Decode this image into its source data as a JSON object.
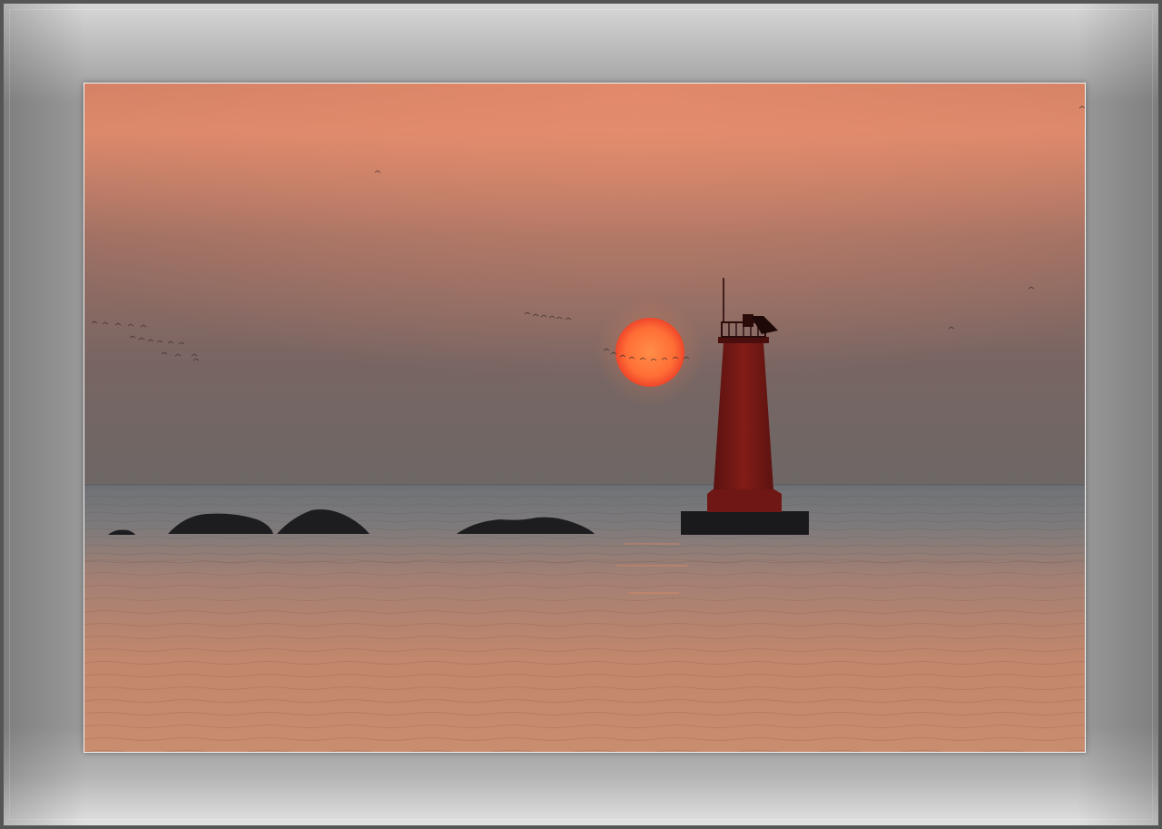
{
  "scene": {
    "subject": "lighthouse-at-sunset",
    "colors": {
      "sky_top": "#d9876a",
      "sky_mid": "#8f6a60",
      "sky_horizon": "#6e6764",
      "sun_center": "#ff7a3c",
      "sun_edge": "#f04b2a",
      "sea_far": "#76787d",
      "sea_near": "#c98a6c",
      "lighthouse": "#7a1a16",
      "silhouette": "#1d1d20",
      "frame": "#9a9a9a"
    }
  }
}
